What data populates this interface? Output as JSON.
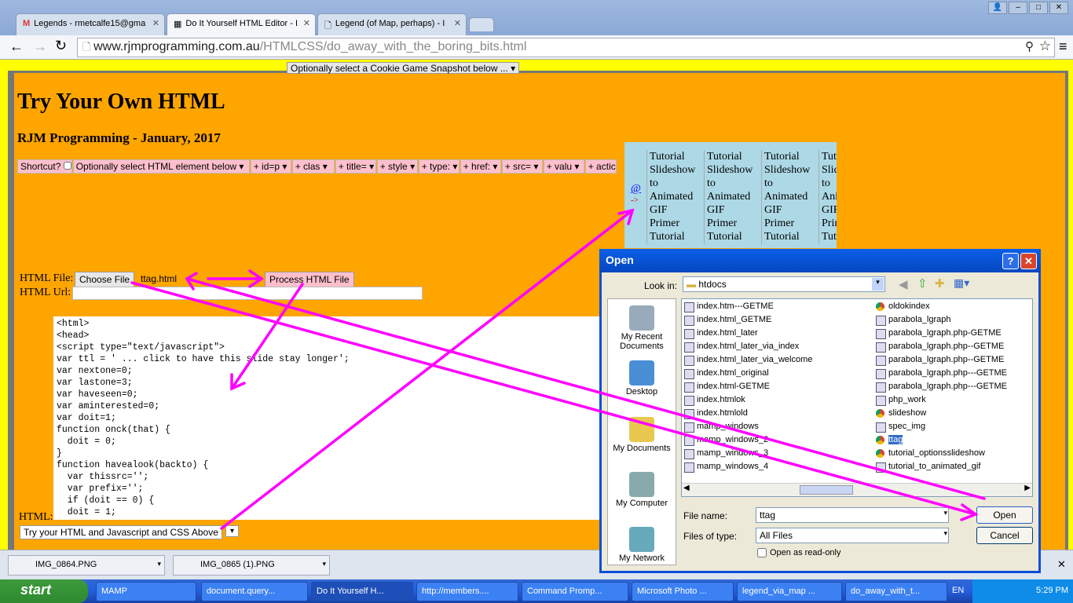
{
  "browser": {
    "tabs": [
      {
        "label": "Legends - rmetcalfe15@gma",
        "icon": "gmail-icon"
      },
      {
        "label": "Do It Yourself HTML Editor - I",
        "icon": "page-icon"
      },
      {
        "label": "Legend (of Map, perhaps) - I",
        "icon": "document-icon"
      }
    ],
    "url_host": "www.rjmprogramming.com.au",
    "url_path": "/HTMLCSS/do_away_with_the_boring_bits.html"
  },
  "page": {
    "cookie_select": "Optionally select a Cookie Game Snapshot below ...",
    "title": "Try Your Own HTML",
    "subtitle": "RJM Programming - January, 2017",
    "shortcut_label": "Shortcut?",
    "selects": [
      "Optionally select HTML element below",
      "+ id=p",
      "+ clas",
      "+ title=",
      "+ style",
      "+ type:",
      "+ href:",
      "+ src=",
      "+ valu",
      "+ actic"
    ],
    "at_link": "@",
    "arrow_text": "->",
    "slides": [
      "Tutorial Slideshow to Animated GIF Primer Tutorial",
      "Tutorial Slideshow to Animated GIF Primer Tutorial",
      "Tutorial Slideshow to Animated GIF Primer Tutorial",
      "Tutorial Slideshow to Animated GIF Primer Tutorial"
    ],
    "html_file_label": "HTML File:",
    "choose_file": "Choose File",
    "chosen_file": "ttag.html",
    "process_button": "Process HTML File",
    "html_url_label": "HTML Url:",
    "html_url_value": "",
    "code": "<html>\n<head>\n<script type=\"text/javascript\">\nvar ttl = ' ... click to have this slide stay longer';\nvar nextone=0;\nvar lastone=3;\nvar haveseen=0;\nvar aminterested=0;\nvar doit=1;\nfunction onck(that) {\n  doit = 0;\n}\nfunction havealook(backto) {\n  var thissrc='';\n  var prefix='';\n  if (doit == 0) {\n  doit = 1;",
    "html_label": "HTML:",
    "try_select": "Try your HTML and Javascript and CSS Above"
  },
  "downloads": [
    "IMG_0864.PNG",
    "IMG_0865 (1).PNG"
  ],
  "dialog": {
    "title": "Open",
    "look_in_label": "Look in:",
    "look_in": "htdocs",
    "places": [
      "My Recent Documents",
      "Desktop",
      "My Documents",
      "My Computer",
      "My Network"
    ],
    "files_col1": [
      "index.htm---GETME",
      "index.html_GETME",
      "index.html_later",
      "index.html_later_via_index",
      "index.html_later_via_welcome",
      "index.html_original",
      "index.html-GETME",
      "index.htmlok",
      "index.htmlold",
      "mamp_windows",
      "mamp_windows_2",
      "mamp_windows_3",
      "mamp_windows_4"
    ],
    "files_col2": [
      "oldokindex",
      "parabola_lgraph",
      "parabola_lgraph.php-GETME",
      "parabola_lgraph.php--GETME",
      "parabola_lgraph.php--GETME",
      "parabola_lgraph.php---GETME",
      "parabola_lgraph.php---GETME",
      "php_work",
      "slideshow",
      "spec_img",
      "ttag",
      "tutorial_optionsslideshow",
      "tutorial_to_animated_gif"
    ],
    "selected_file": "ttag",
    "file_name_label": "File name:",
    "file_name": "ttag",
    "files_of_type_label": "Files of type:",
    "files_of_type": "All Files",
    "readonly_label": "Open as read-only",
    "open": "Open",
    "cancel": "Cancel"
  },
  "taskbar": {
    "start": "start",
    "items": [
      "MAMP",
      "document.query...",
      "Do It Yourself H...",
      "http://members....",
      "Command Promp...",
      "Microsoft Photo ...",
      "legend_via_map ...",
      "do_away_with_t..."
    ],
    "lang": "EN",
    "clock": "5:29 PM"
  },
  "colors": {
    "page_bg": "#ffa500",
    "border": "#ffff00",
    "arrows": "#ff00ff",
    "select_bg": "#ffc0cb"
  }
}
